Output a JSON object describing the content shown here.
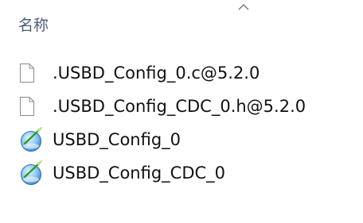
{
  "header": {
    "column_name": "名称",
    "sort_indicator": "chevron-up-icon"
  },
  "files": [
    {
      "name": ".USBD_Config_0.c@5.2.0",
      "icon": "blank-file-icon"
    },
    {
      "name": ".USBD_Config_CDC_0.h@5.2.0",
      "icon": "blank-file-icon"
    },
    {
      "name": "USBD_Config_0",
      "icon": "configuration-wizard-icon"
    },
    {
      "name": "USBD_Config_CDC_0",
      "icon": "configuration-wizard-icon"
    }
  ],
  "colors": {
    "header_text": "#4f5b75",
    "file_text": "#111111"
  }
}
